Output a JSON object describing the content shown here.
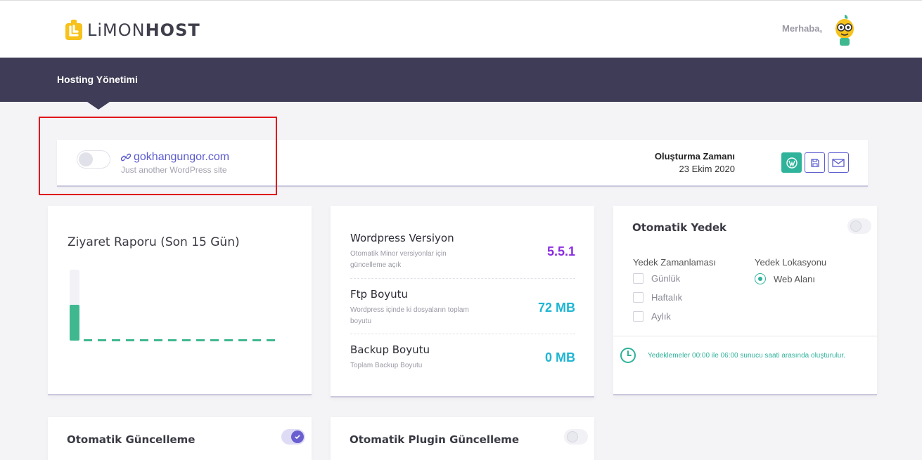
{
  "header": {
    "logo_part1": "LiMON",
    "logo_part2": "HOST",
    "greeting": "Merhaba,"
  },
  "nav": {
    "item": "Hosting Yönetimi"
  },
  "site": {
    "domain": "gokhangungor.com",
    "tagline": "Just another WordPress site",
    "created_label": "Oluşturma Zamanı",
    "created_date": "23 Ekim 2020",
    "enabled": false,
    "actions": [
      "wordpress-icon",
      "save-icon",
      "mail-icon"
    ]
  },
  "visit_report": {
    "title": "Ziyaret Raporu (Son 15 Gün)"
  },
  "chart_data": {
    "type": "bar",
    "title": "Ziyaret Raporu (Son 15 Gün)",
    "values": [
      1,
      0,
      0,
      0,
      0,
      0,
      0,
      0,
      0,
      0,
      0,
      0,
      0,
      0,
      0
    ],
    "ylim": [
      0,
      2
    ],
    "colors": {
      "bar": "#3fb890",
      "track": "#f1f1f6"
    }
  },
  "info": {
    "rows": [
      {
        "title": "Wordpress Versiyon",
        "desc": "Otomatik Minor versiyonlar için güncelleme açık",
        "value": "5.5.1",
        "color": "#8a2be2"
      },
      {
        "title": "Ftp Boyutu",
        "desc": "Wordpress içinde ki dosyaların toplam boyutu",
        "value": "72 MB",
        "color": "#1fb5d3"
      },
      {
        "title": "Backup Boyutu",
        "desc": "Toplam Backup Boyutu",
        "value": "0 MB",
        "color": "#1fb5d3"
      }
    ]
  },
  "backup": {
    "title": "Otomatik Yedek",
    "enabled": false,
    "schedule_label": "Yedek Zamanlaması",
    "location_label": "Yedek Lokasyonu",
    "schedule_options": [
      "Günlük",
      "Haftalık",
      "Aylık"
    ],
    "location_option": "Web Alanı",
    "note": "Yedeklemeler 00:00 ile 06:00 sunucu saati arasında oluşturulur."
  },
  "auto_update": {
    "title": "Otomatik Güncelleme",
    "enabled": true
  },
  "plugin_update": {
    "title": "Otomatik Plugin Güncelleme",
    "enabled": false
  },
  "colors": {
    "navbar": "#3e3c56",
    "accent": "#5b5bd0",
    "green": "#2fb39b",
    "highlight": "#e0161c"
  }
}
